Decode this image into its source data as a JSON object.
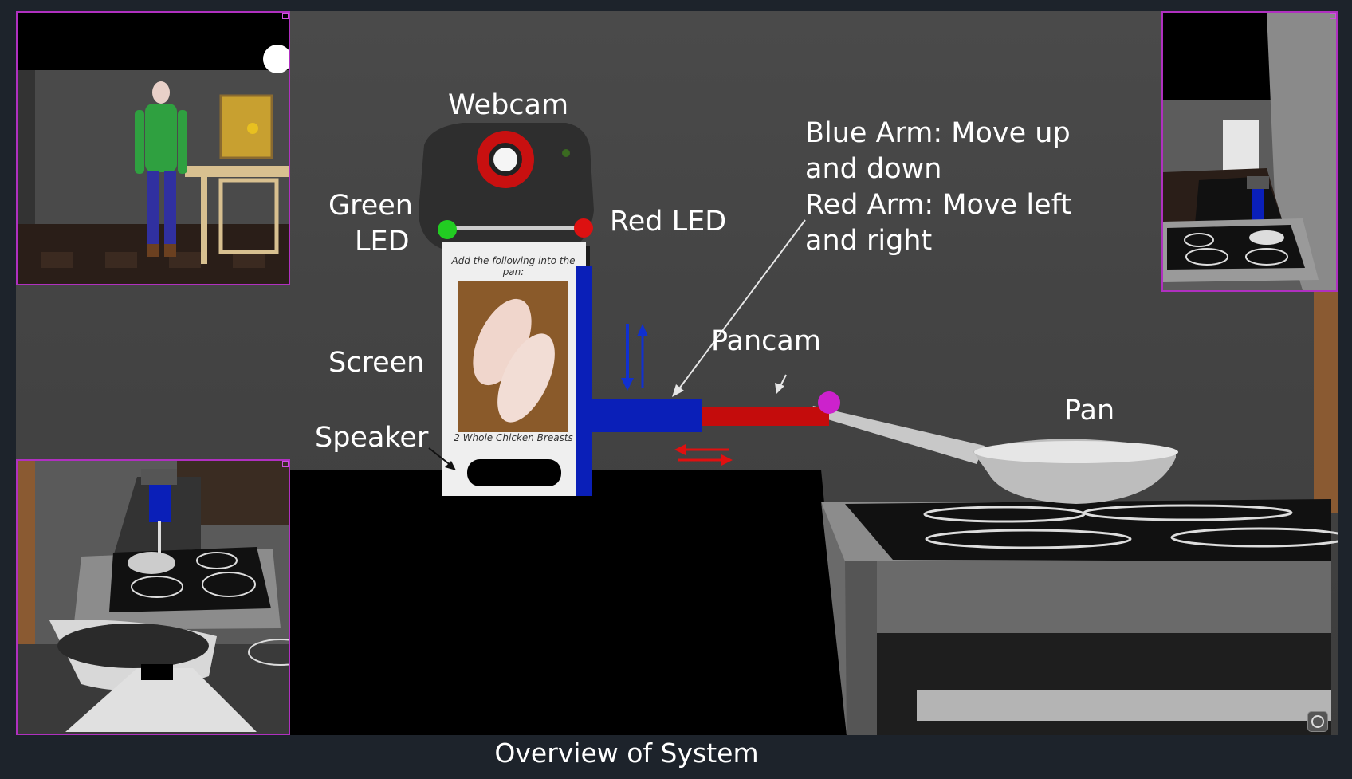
{
  "caption": "Overview of System",
  "labels": {
    "webcam": "Webcam",
    "green_led_1": "Green",
    "green_led_2": "LED",
    "red_led": "Red LED",
    "screen": "Screen",
    "speaker": "Speaker",
    "pancam": "Pancam",
    "pan": "Pan",
    "arm_note_1": "Blue Arm: Move up",
    "arm_note_2": "and down",
    "arm_note_3": "Red Arm: Move left",
    "arm_note_4": "and right"
  },
  "device_screen": {
    "instruction": "Add the following into the pan:",
    "item": "2 Whole Chicken Breasts"
  },
  "colors": {
    "blue_arm": "#0a1fb8",
    "red_arm": "#c40c0c",
    "pancam_joint": "#cc22cc",
    "green_led": "#22cc22",
    "red_led": "#dd1111",
    "view_border": "#b030c0"
  },
  "icons": {
    "camera_toggle": "circle-arrow-icon"
  }
}
